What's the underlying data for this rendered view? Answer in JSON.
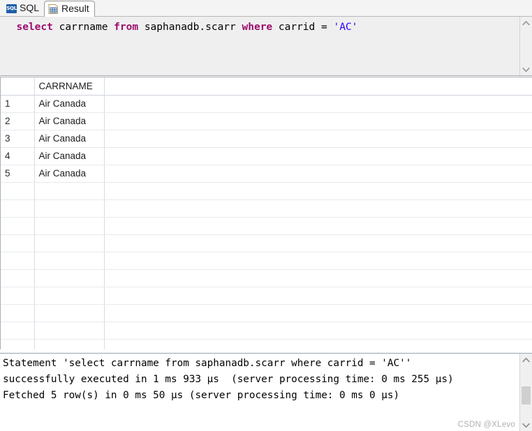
{
  "tabs": [
    {
      "id": "sql",
      "label": "SQL",
      "icon": "sql-icon",
      "active": false
    },
    {
      "id": "result",
      "label": "Result",
      "icon": "table-grid-icon",
      "active": true
    }
  ],
  "editor": {
    "name": "sql-editor",
    "background": "#efefef",
    "tokens": [
      {
        "text": "select",
        "type": "keyword"
      },
      {
        "text": " carrname ",
        "type": "plain"
      },
      {
        "text": "from",
        "type": "keyword"
      },
      {
        "text": " saphanadb.scarr ",
        "type": "plain"
      },
      {
        "text": "where",
        "type": "keyword"
      },
      {
        "text": " carrid = ",
        "type": "plain"
      },
      {
        "text": "'AC'",
        "type": "string"
      }
    ],
    "plain_text": "select carrname from saphanadb.scarr where carrid = 'AC'",
    "colors": {
      "keyword": "#9c0d6e",
      "string": "#2a00ff",
      "plain": "#000000"
    }
  },
  "result_grid": {
    "columns": [
      "",
      "CARRNAME",
      ""
    ],
    "rows": [
      {
        "num": "1",
        "carrname": "Air Canada"
      },
      {
        "num": "2",
        "carrname": "Air Canada"
      },
      {
        "num": "3",
        "carrname": "Air Canada"
      },
      {
        "num": "4",
        "carrname": "Air Canada"
      },
      {
        "num": "5",
        "carrname": "Air Canada"
      }
    ],
    "empty_row_count": 10
  },
  "messages": {
    "lines": [
      "Statement 'select carrname from saphanadb.scarr where carrid = 'AC''",
      "successfully executed in 1 ms 933 µs  (server processing time: 0 ms 255 µs)",
      "Fetched 5 row(s) in 0 ms 50 µs (server processing time: 0 ms 0 µs)"
    ]
  },
  "scrollbars": {
    "up_arrow": "⌃",
    "down_arrow": "⌄"
  },
  "watermark": "CSDN @XLevo"
}
